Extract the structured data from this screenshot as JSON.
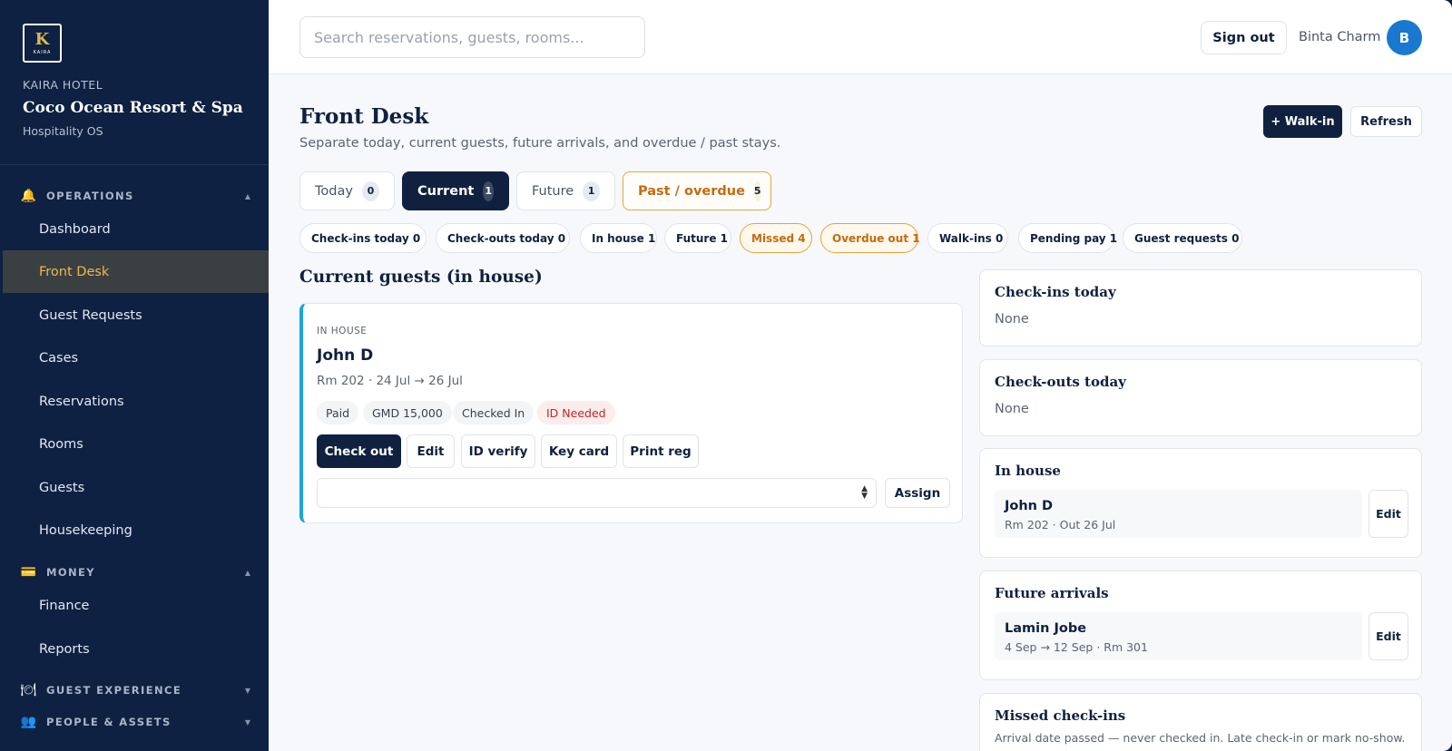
{
  "sidebar": {
    "logo": {
      "initial": "K",
      "text": "KAIRA"
    },
    "hotel_label": "KAIRA HOTEL",
    "hotel_name": "Coco Ocean Resort & Spa",
    "hotel_sub": "Hospitality OS",
    "sections": {
      "operations": {
        "label": "OPERATIONS",
        "icon": "bell-icon",
        "glyph": "🔔",
        "caret": "▲"
      },
      "money": {
        "label": "MONEY",
        "icon": "credit-card-icon",
        "glyph": "💳",
        "caret": "▲"
      },
      "guest_experience": {
        "label": "GUEST EXPERIENCE",
        "icon": "dining-plate-icon",
        "glyph": "🍽",
        "caret": "▼"
      },
      "people_assets": {
        "label": "PEOPLE & ASSETS",
        "icon": "people-icon",
        "glyph": "👥",
        "caret": "▼"
      }
    },
    "items": {
      "dashboard": "Dashboard",
      "front_desk": "Front Desk",
      "guest_requests": "Guest Requests",
      "cases": "Cases",
      "reservations": "Reservations",
      "rooms": "Rooms",
      "guests": "Guests",
      "housekeeping": "Housekeeping",
      "finance": "Finance",
      "reports": "Reports"
    },
    "active_item": "Front Desk",
    "active_color": "#f2b84b"
  },
  "topbar": {
    "search_placeholder": "Search reservations, guests, rooms...",
    "sign_out": "Sign out",
    "user_name": "Binta Charm",
    "avatar_initial": "B",
    "avatar_color": "#1a78d0"
  },
  "header": {
    "title": "Front Desk",
    "subtitle": "Separate today, current guests, future arrivals, and overdue / past stays.",
    "walkin_label": "+ Walk-in",
    "refresh_label": "Refresh"
  },
  "tabs": {
    "today": {
      "label": "Today",
      "count": "0"
    },
    "current": {
      "label": "Current",
      "count": "1"
    },
    "future": {
      "label": "Future",
      "count": "1"
    },
    "past": {
      "label": "Past / overdue",
      "count": "5"
    },
    "active": "Current"
  },
  "chips": {
    "checkins": "Check-ins today 0",
    "checkouts": "Check-outs today 0",
    "inhouse": "In house 1",
    "future": "Future 1",
    "missed": "Missed 4",
    "overdue": "Overdue out 1",
    "walkins": "Walk-ins 0",
    "pending": "Pending pay 1",
    "requests": "Guest requests 0"
  },
  "current_section": {
    "title": "Current guests (in house)",
    "card": {
      "status": "IN HOUSE",
      "name": "John D",
      "meta": "Rm 202 · 24 Jul → 26 Jul",
      "badges": {
        "paid": "Paid",
        "amount": "GMD 15,000",
        "checked_in": "Checked In",
        "id_needed": "ID Needed"
      },
      "actions": {
        "check_out": "Check out",
        "edit": "Edit",
        "id_verify": "ID verify",
        "key_card": "Key card",
        "print_reg": "Print reg"
      },
      "select_value": "",
      "assign": "Assign"
    }
  },
  "panels": {
    "checkins": {
      "title": "Check-ins today",
      "empty": "None"
    },
    "checkouts": {
      "title": "Check-outs today",
      "empty": "None"
    },
    "inhouse": {
      "title": "In house",
      "name": "John D",
      "sub": "Rm 202 · Out 26 Jul",
      "edit": "Edit"
    },
    "future": {
      "title": "Future arrivals",
      "name": "Lamin Jobe",
      "sub": "4 Sep → 12 Sep · Rm 301",
      "edit": "Edit"
    },
    "missed": {
      "title": "Missed check-ins",
      "note": "Arrival date passed — never checked in. Late check-in or mark no-show."
    }
  },
  "colors": {
    "navy": "#0f213f",
    "accent_blue": "#1aa5e0",
    "warning_orange": "#e8a43a",
    "danger_red": "#c0282a"
  }
}
